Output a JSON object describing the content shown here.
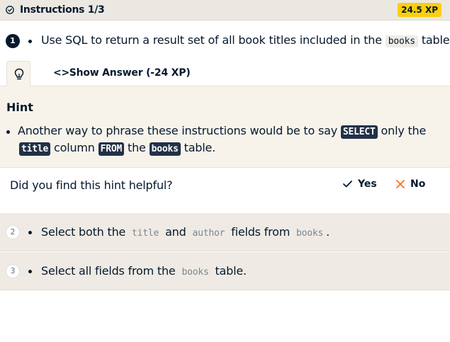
{
  "header": {
    "title": "Instructions 1/3",
    "xp": "24.5 XP"
  },
  "step1": {
    "number": "1",
    "text_before": "Use SQL to return a result set of all book titles included in the",
    "code": "books",
    "text_after": "table."
  },
  "tabs": {
    "hint_icon": "lightbulb-icon",
    "show_answer_label": "Show Answer (-24 XP)"
  },
  "hint": {
    "heading": "Hint",
    "line1_before": "Another way to phrase these instructions would be to say",
    "code_select": "SELECT",
    "line1_after": "only the",
    "code_title": "title",
    "line2_mid1": "column",
    "code_from": "FROM",
    "line2_mid2": "the",
    "code_books": "books",
    "line2_after": "table."
  },
  "feedback": {
    "question": "Did you find this hint helpful?",
    "yes_label": "Yes",
    "no_label": "No"
  },
  "step2": {
    "number": "2",
    "t1": "Select both the",
    "c1": "title",
    "t2": "and",
    "c2": "author",
    "t3": "fields from",
    "c3": "books",
    "t4": "."
  },
  "step3": {
    "number": "3",
    "t1": "Select all fields from the",
    "c1": "books",
    "t2": "table."
  },
  "colors": {
    "accent_yellow": "#fcce0d",
    "navy": "#05192d",
    "no_orange": "#ff6d1f"
  }
}
